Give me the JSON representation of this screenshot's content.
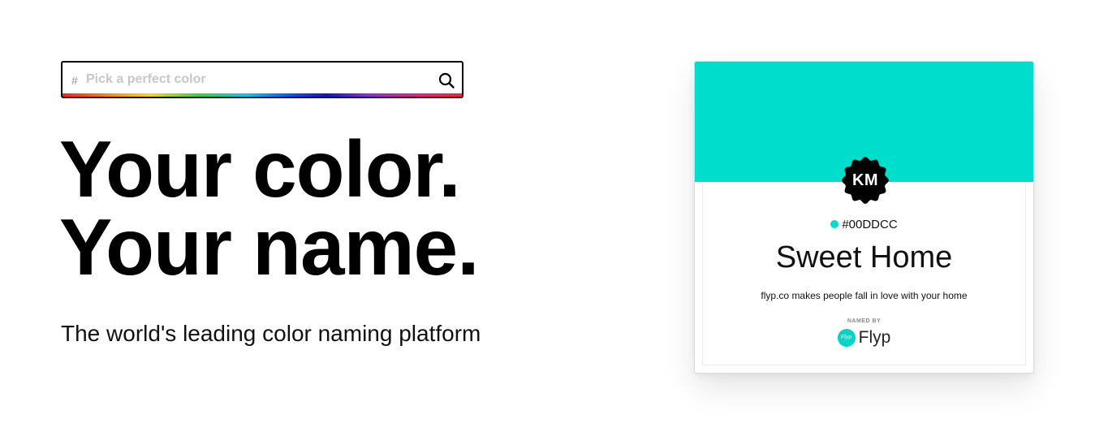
{
  "search": {
    "hash_symbol": "#",
    "placeholder": "Pick a perfect color",
    "value": "",
    "icon": "search-icon"
  },
  "hero": {
    "headline_line1": "Your color.",
    "headline_line2": "Your name.",
    "subtitle": "The world's leading color naming platform"
  },
  "card": {
    "color_hex": "#00DDCC",
    "swatch_color": "#00DDCC",
    "badge_initials": "KM",
    "badge_color": "#000000",
    "hex_label": "#00DDCC",
    "color_name": "Sweet Home",
    "tagline": "flyp.co makes people fall in love with your home",
    "named_by_label": "NAMED BY",
    "brand_logo_text": "Flyp",
    "brand_name": "Flyp",
    "brand_color": "#00D4C4"
  }
}
